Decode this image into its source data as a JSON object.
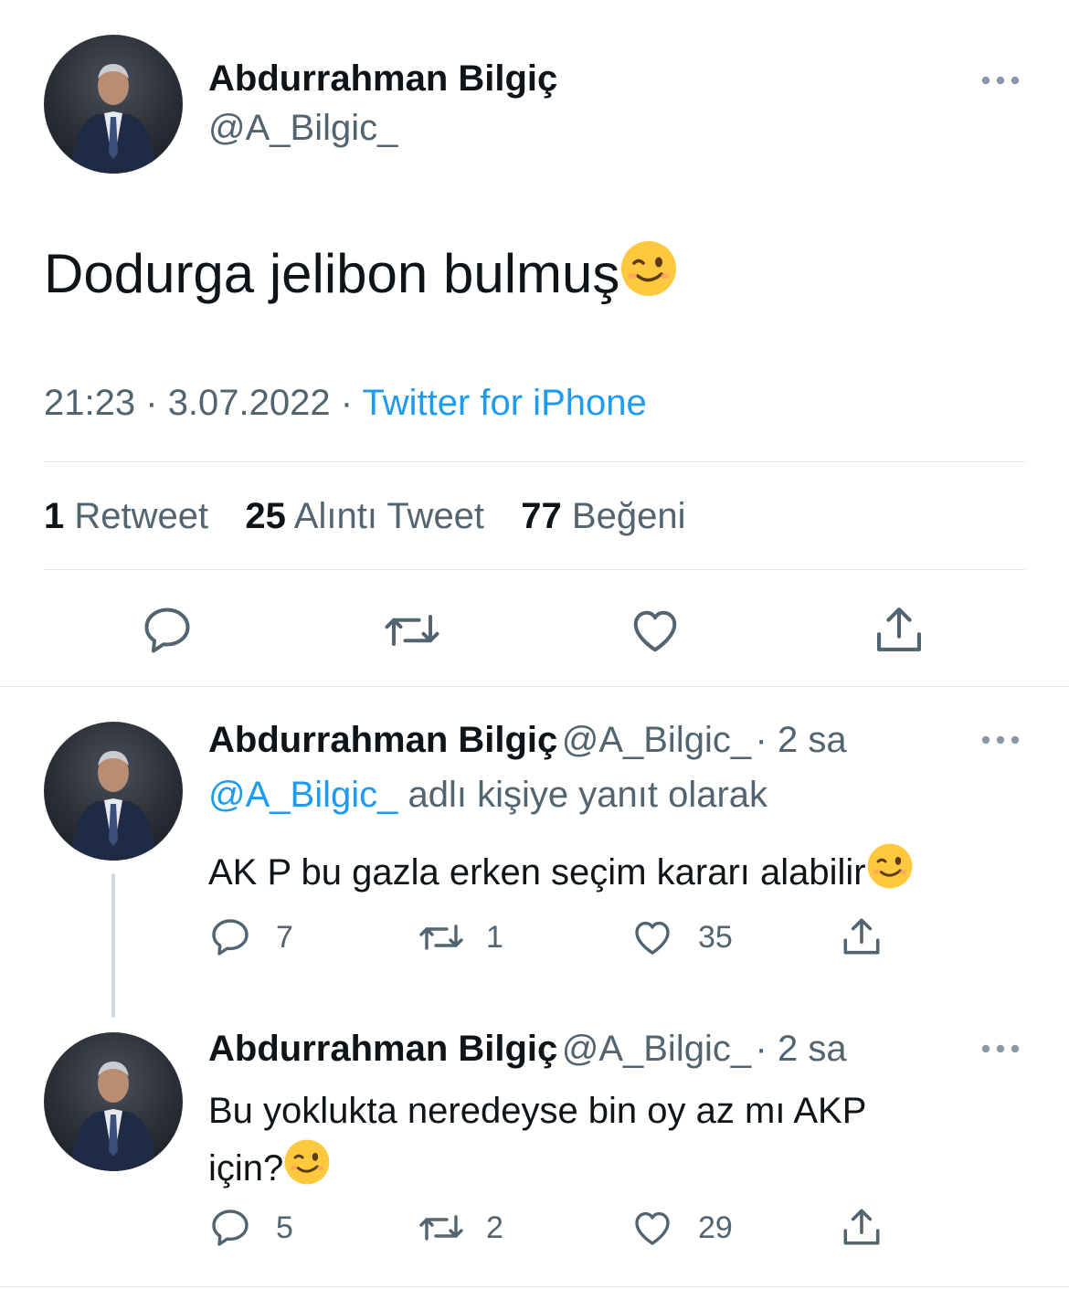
{
  "main": {
    "author_name": "Abdurrahman Bilgiç",
    "author_handle": "@A_Bilgic_",
    "text": "Dodurga jelibon bulmuş",
    "time": "21:23",
    "separator": "·",
    "date": "3.07.2022",
    "source": "Twitter for iPhone",
    "stats": [
      {
        "count": "1",
        "label": "Retweet"
      },
      {
        "count": "25",
        "label": "Alıntı Tweet"
      },
      {
        "count": "77",
        "label": "Beğeni"
      }
    ],
    "actions": [
      "reply-icon",
      "retweet-icon",
      "like-icon",
      "share-icon"
    ]
  },
  "replies": [
    {
      "author_name": "Abdurrahman Bilgiç",
      "author_handle": "@A_Bilgic_",
      "time": "· 2 sa",
      "replying_handle": "@A_Bilgic_",
      "replying_text": "adlı kişiye yanıt olarak",
      "text_line1": "AK P bu gazla erken seçim kararı alabilir",
      "text_line2": "",
      "reply_count": "7",
      "retweet_count": "1",
      "like_count": "35"
    },
    {
      "author_name": "Abdurrahman Bilgiç",
      "author_handle": "@A_Bilgic_",
      "time": "· 2 sa",
      "text_line1": "Bu yoklukta neredeyse bin oy az mı AKP",
      "text_line2": "için?",
      "reply_count": "5",
      "retweet_count": "2",
      "like_count": "29"
    }
  ],
  "colors": {
    "accent": "#1d9bf0",
    "secondary_text": "#536471",
    "divider": "#e6e9ec",
    "thread_line": "#cfd9de"
  }
}
